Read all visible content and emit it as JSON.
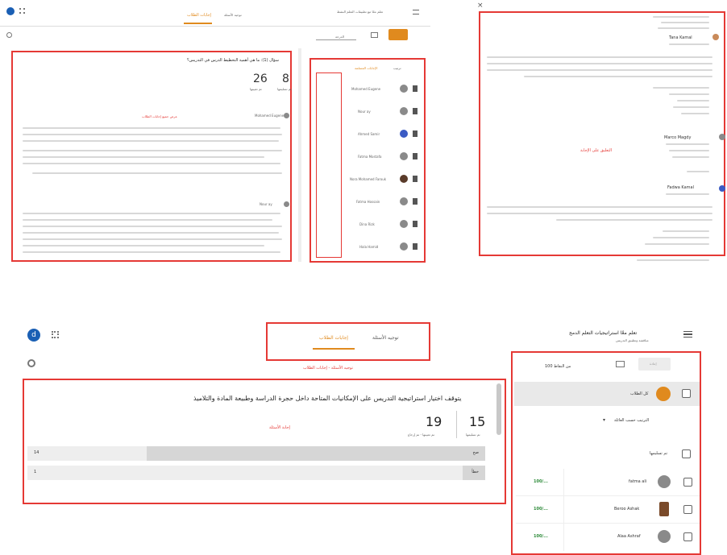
{
  "top_left": {
    "header": {
      "title": "تعلم معًا مع تطبيقات التعلم النشط",
      "subtitle": "",
      "tabs": [
        {
          "label": "توجيه الأسئلة"
        },
        {
          "label": "إجابات الطلاب"
        }
      ],
      "return_button": "",
      "grade_label": "الدرجة"
    },
    "question": {
      "text": "سؤال (1): ما هي أهمية التخطيط الدرس في التدريس؟",
      "stat_answered": "8",
      "stat_answered_label": "تم تسليمها",
      "stat_assigned": "26",
      "stat_assigned_label": "تم تعيينها",
      "link": "عرض جميع إجابات الطلاب"
    },
    "answers": [
      {
        "name": "Mohamed Eugene",
        "date": ""
      },
      {
        "name": "Nour ay",
        "date": ""
      }
    ],
    "students": [
      {
        "name": "Mohamed Eugene"
      },
      {
        "name": "Nour ay"
      },
      {
        "name": "Ahmed Samir"
      },
      {
        "name": "Fatma Mostafa"
      },
      {
        "name": "Nora Mohamed Farouk"
      },
      {
        "name": "Fatma Hossain"
      },
      {
        "name": "Dina Rizk"
      },
      {
        "name": "Hala Hamid"
      }
    ],
    "student_tabs": {
      "answered": "الإجابات المسلمة",
      "sort": "ترتيب"
    }
  },
  "top_right": {
    "center_text": "التعليق على الإجابة",
    "commenters": [
      {
        "name": "Tana Kamal"
      },
      {
        "name": "Marco Magdy"
      },
      {
        "name": "Fadwa Kamal"
      }
    ]
  },
  "bottom": {
    "header": {
      "menu_icon": "hamburger-icon",
      "title": "تعلم معًا استراتيجيات التعلم الدمج",
      "subtitle": "مناقشة وتطبيق التدريس",
      "tabs": [
        {
          "label": "توجيه الأسئلة",
          "active": false
        },
        {
          "label": "إجابات الطلاب",
          "active": true
        }
      ],
      "breadcrumb": "توجيه الأسئلة - إجابات الطلاب",
      "avatar_letter": "d"
    },
    "sidebar": {
      "return_button": "إعادة",
      "points": "100 من النقاط",
      "all_students": "كل الطلاب",
      "sort_label": "الترتيب حسب العائلة",
      "group_label": "تم تسليمها",
      "students": [
        {
          "name": "fatma ali",
          "grade": "100/..."
        },
        {
          "name": "Beroo Ashak",
          "grade": "100/..."
        },
        {
          "name": "Alaa Ashraf",
          "grade": "100/..."
        }
      ]
    },
    "question": {
      "text": "يتوقف اختيار استراتيجية التدريس على الإمكانيات المتاحة داخل حجرة الدراسة وطبيعة المادة والتلاميذ",
      "stat_answered": "15",
      "stat_answered_label": "تم تسليمها",
      "stat_assigned": "19",
      "stat_assigned_label": "تم تعيينها - تم إرجاع",
      "link": "إجابة الأسئلة",
      "options": [
        {
          "label": "صح",
          "count": "14",
          "fill": 0.74
        },
        {
          "label": "خطأ",
          "count": "1",
          "fill": 0.05
        }
      ]
    }
  },
  "colors": {
    "accent": "#e08a1e",
    "annotation": "#e53935",
    "grade_green": "#2e8b3a",
    "avatar_blue": "#1a5fb4"
  }
}
